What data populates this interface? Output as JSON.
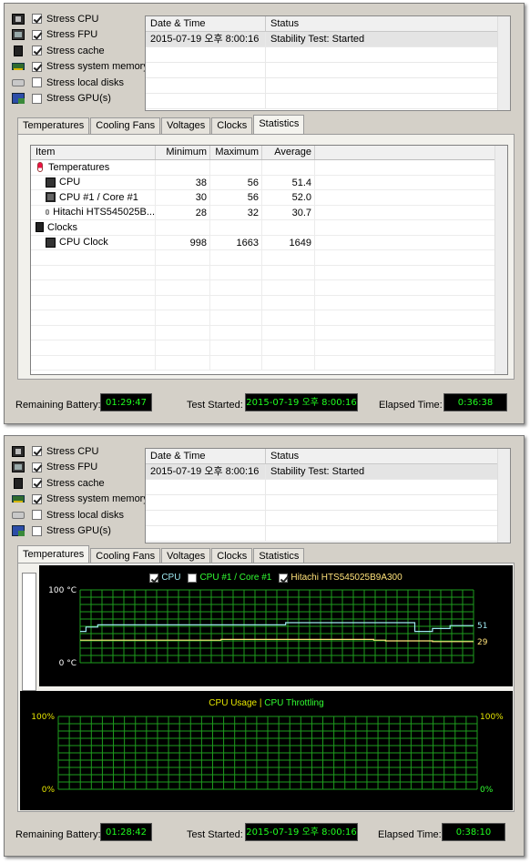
{
  "options": [
    {
      "icon": "cpu-chip-icon",
      "label": "Stress CPU",
      "checked": true
    },
    {
      "icon": "fpu-chip-icon",
      "label": "Stress FPU",
      "checked": true
    },
    {
      "icon": "cache-chip-icon",
      "label": "Stress cache",
      "checked": true
    },
    {
      "icon": "memory-module-icon",
      "label": "Stress system memory",
      "checked": true
    },
    {
      "icon": "local-disk-icon",
      "label": "Stress local disks",
      "checked": false
    },
    {
      "icon": "gpu-card-icon",
      "label": "Stress GPU(s)",
      "checked": false
    }
  ],
  "log": {
    "headers": {
      "date": "Date & Time",
      "status": "Status"
    },
    "rows": [
      {
        "date": "2015-07-19 오후 8:00:16",
        "status": "Stability Test: Started"
      }
    ]
  },
  "tabs": [
    "Temperatures",
    "Cooling Fans",
    "Voltages",
    "Clocks",
    "Statistics"
  ],
  "window1": {
    "active_tab": "Statistics"
  },
  "window2": {
    "active_tab": "Temperatures"
  },
  "statistics": {
    "headers": {
      "item": "Item",
      "min": "Minimum",
      "max": "Maximum",
      "avg": "Average"
    },
    "rows": [
      {
        "item": "Temperatures",
        "icon": "thermometer-icon",
        "indent": 0,
        "min": "",
        "max": "",
        "avg": ""
      },
      {
        "item": "CPU",
        "icon": "cpu-icon",
        "indent": 1,
        "min": "38",
        "max": "56",
        "avg": "51.4"
      },
      {
        "item": "CPU #1 / Core #1",
        "icon": "core-icon",
        "indent": 1,
        "min": "30",
        "max": "56",
        "avg": "52.0"
      },
      {
        "item": "Hitachi HTS545025B...",
        "icon": "hard-drive-icon",
        "indent": 1,
        "min": "28",
        "max": "32",
        "avg": "30.7"
      },
      {
        "item": "Clocks",
        "icon": "clock-chip-icon",
        "indent": 0,
        "min": "",
        "max": "",
        "avg": ""
      },
      {
        "item": "CPU Clock",
        "icon": "cpu-icon",
        "indent": 1,
        "min": "998",
        "max": "1663",
        "avg": "1649"
      }
    ]
  },
  "footer1": {
    "battery_label": "Remaining Battery:",
    "battery": "01:29:47",
    "started_label": "Test Started:",
    "started": "2015-07-19 오후 8:00:16",
    "elapsed_label": "Elapsed Time:",
    "elapsed": "0:36:38"
  },
  "footer2": {
    "battery_label": "Remaining Battery:",
    "battery": "01:28:42",
    "started_label": "Test Started:",
    "started": "2015-07-19 오후 8:00:16",
    "elapsed_label": "Elapsed Time:",
    "elapsed": "0:38:10"
  },
  "colors": {
    "cpu": "#9ee8f0",
    "core": "#32ff32",
    "hitachi": "#ffe27a",
    "grid": "#1e9e1e",
    "usage": "#e6e600",
    "throttling": "#32ff32"
  },
  "chart_data": [
    {
      "type": "line",
      "legend": [
        {
          "label": "CPU",
          "checked": true,
          "color": "#9ee8f0"
        },
        {
          "label": "CPU #1 / Core #1",
          "checked": false,
          "color": "#32ff32"
        },
        {
          "label": "Hitachi HTS545025B9A300",
          "checked": true,
          "color": "#ffe27a"
        }
      ],
      "ylabel_top": "100 °C",
      "ylabel_bottom": "0 °C",
      "ylim": [
        0,
        100
      ],
      "grid": true,
      "series": [
        {
          "name": "CPU",
          "color": "#9ee8f0",
          "end_label": "51",
          "values": [
            43,
            49,
            49,
            52,
            52,
            52,
            52,
            52,
            52,
            52,
            52,
            52,
            52,
            52,
            52,
            52,
            52,
            52,
            52,
            52,
            52,
            52,
            52,
            52,
            52,
            52,
            52,
            52,
            52,
            52,
            52,
            52,
            52,
            52,
            52,
            55,
            55,
            55,
            55,
            55,
            55,
            55,
            55,
            55,
            55,
            55,
            55,
            55,
            55,
            55,
            55,
            55,
            55,
            55,
            55,
            55,
            55,
            43,
            43,
            43,
            47,
            47,
            47,
            51,
            51,
            51,
            51,
            51
          ]
        },
        {
          "name": "Hitachi HTS545025B9A300",
          "color": "#ffe27a",
          "end_label": "29",
          "values": [
            31,
            31,
            31,
            31,
            31,
            31,
            31,
            31,
            31,
            31,
            31,
            31,
            31,
            31,
            31,
            31,
            31,
            31,
            31,
            31,
            31,
            31,
            31,
            31,
            32,
            32,
            32,
            32,
            32,
            32,
            32,
            32,
            32,
            32,
            32,
            32,
            32,
            32,
            32,
            32,
            32,
            32,
            32,
            32,
            32,
            32,
            32,
            32,
            32,
            32,
            31,
            31,
            30,
            30,
            30,
            30,
            30,
            30,
            30,
            30,
            29,
            29,
            29,
            29,
            29,
            29,
            29,
            29
          ]
        }
      ]
    },
    {
      "type": "line",
      "legend": [
        {
          "label": "CPU Usage",
          "color": "#e6e600"
        },
        {
          "label": "CPU Throttling",
          "color": "#32ff32"
        }
      ],
      "ylabel_top": "100%",
      "ylabel_bottom": "0%",
      "ylabel_top_right": "100%",
      "ylabel_bottom_right": "0%",
      "ylim": [
        0,
        100
      ],
      "grid": true,
      "series": []
    }
  ]
}
